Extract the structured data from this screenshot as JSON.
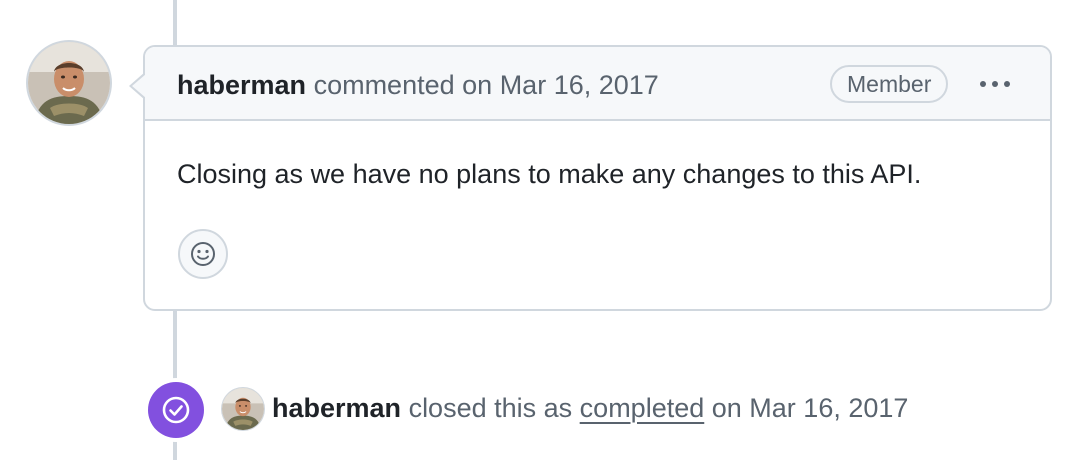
{
  "comment": {
    "author": "haberman",
    "action": "commented on",
    "date": "Mar 16, 2017",
    "badge": "Member",
    "menu_icon": "kebab-horizontal-icon",
    "body": "Closing as we have no plans to make any changes to this API.",
    "reaction_icon": "smiley-icon"
  },
  "event": {
    "icon": "check-circle-icon",
    "icon_color": "#8250df",
    "author": "haberman",
    "action_prefix": "closed this as",
    "status_link": "completed",
    "action_suffix": "on Mar 16, 2017"
  },
  "colors": {
    "border": "#d0d7de",
    "header_bg": "#f6f8fa",
    "muted_text": "#59636e",
    "text": "#1f2328",
    "closed_badge": "#8250df"
  }
}
